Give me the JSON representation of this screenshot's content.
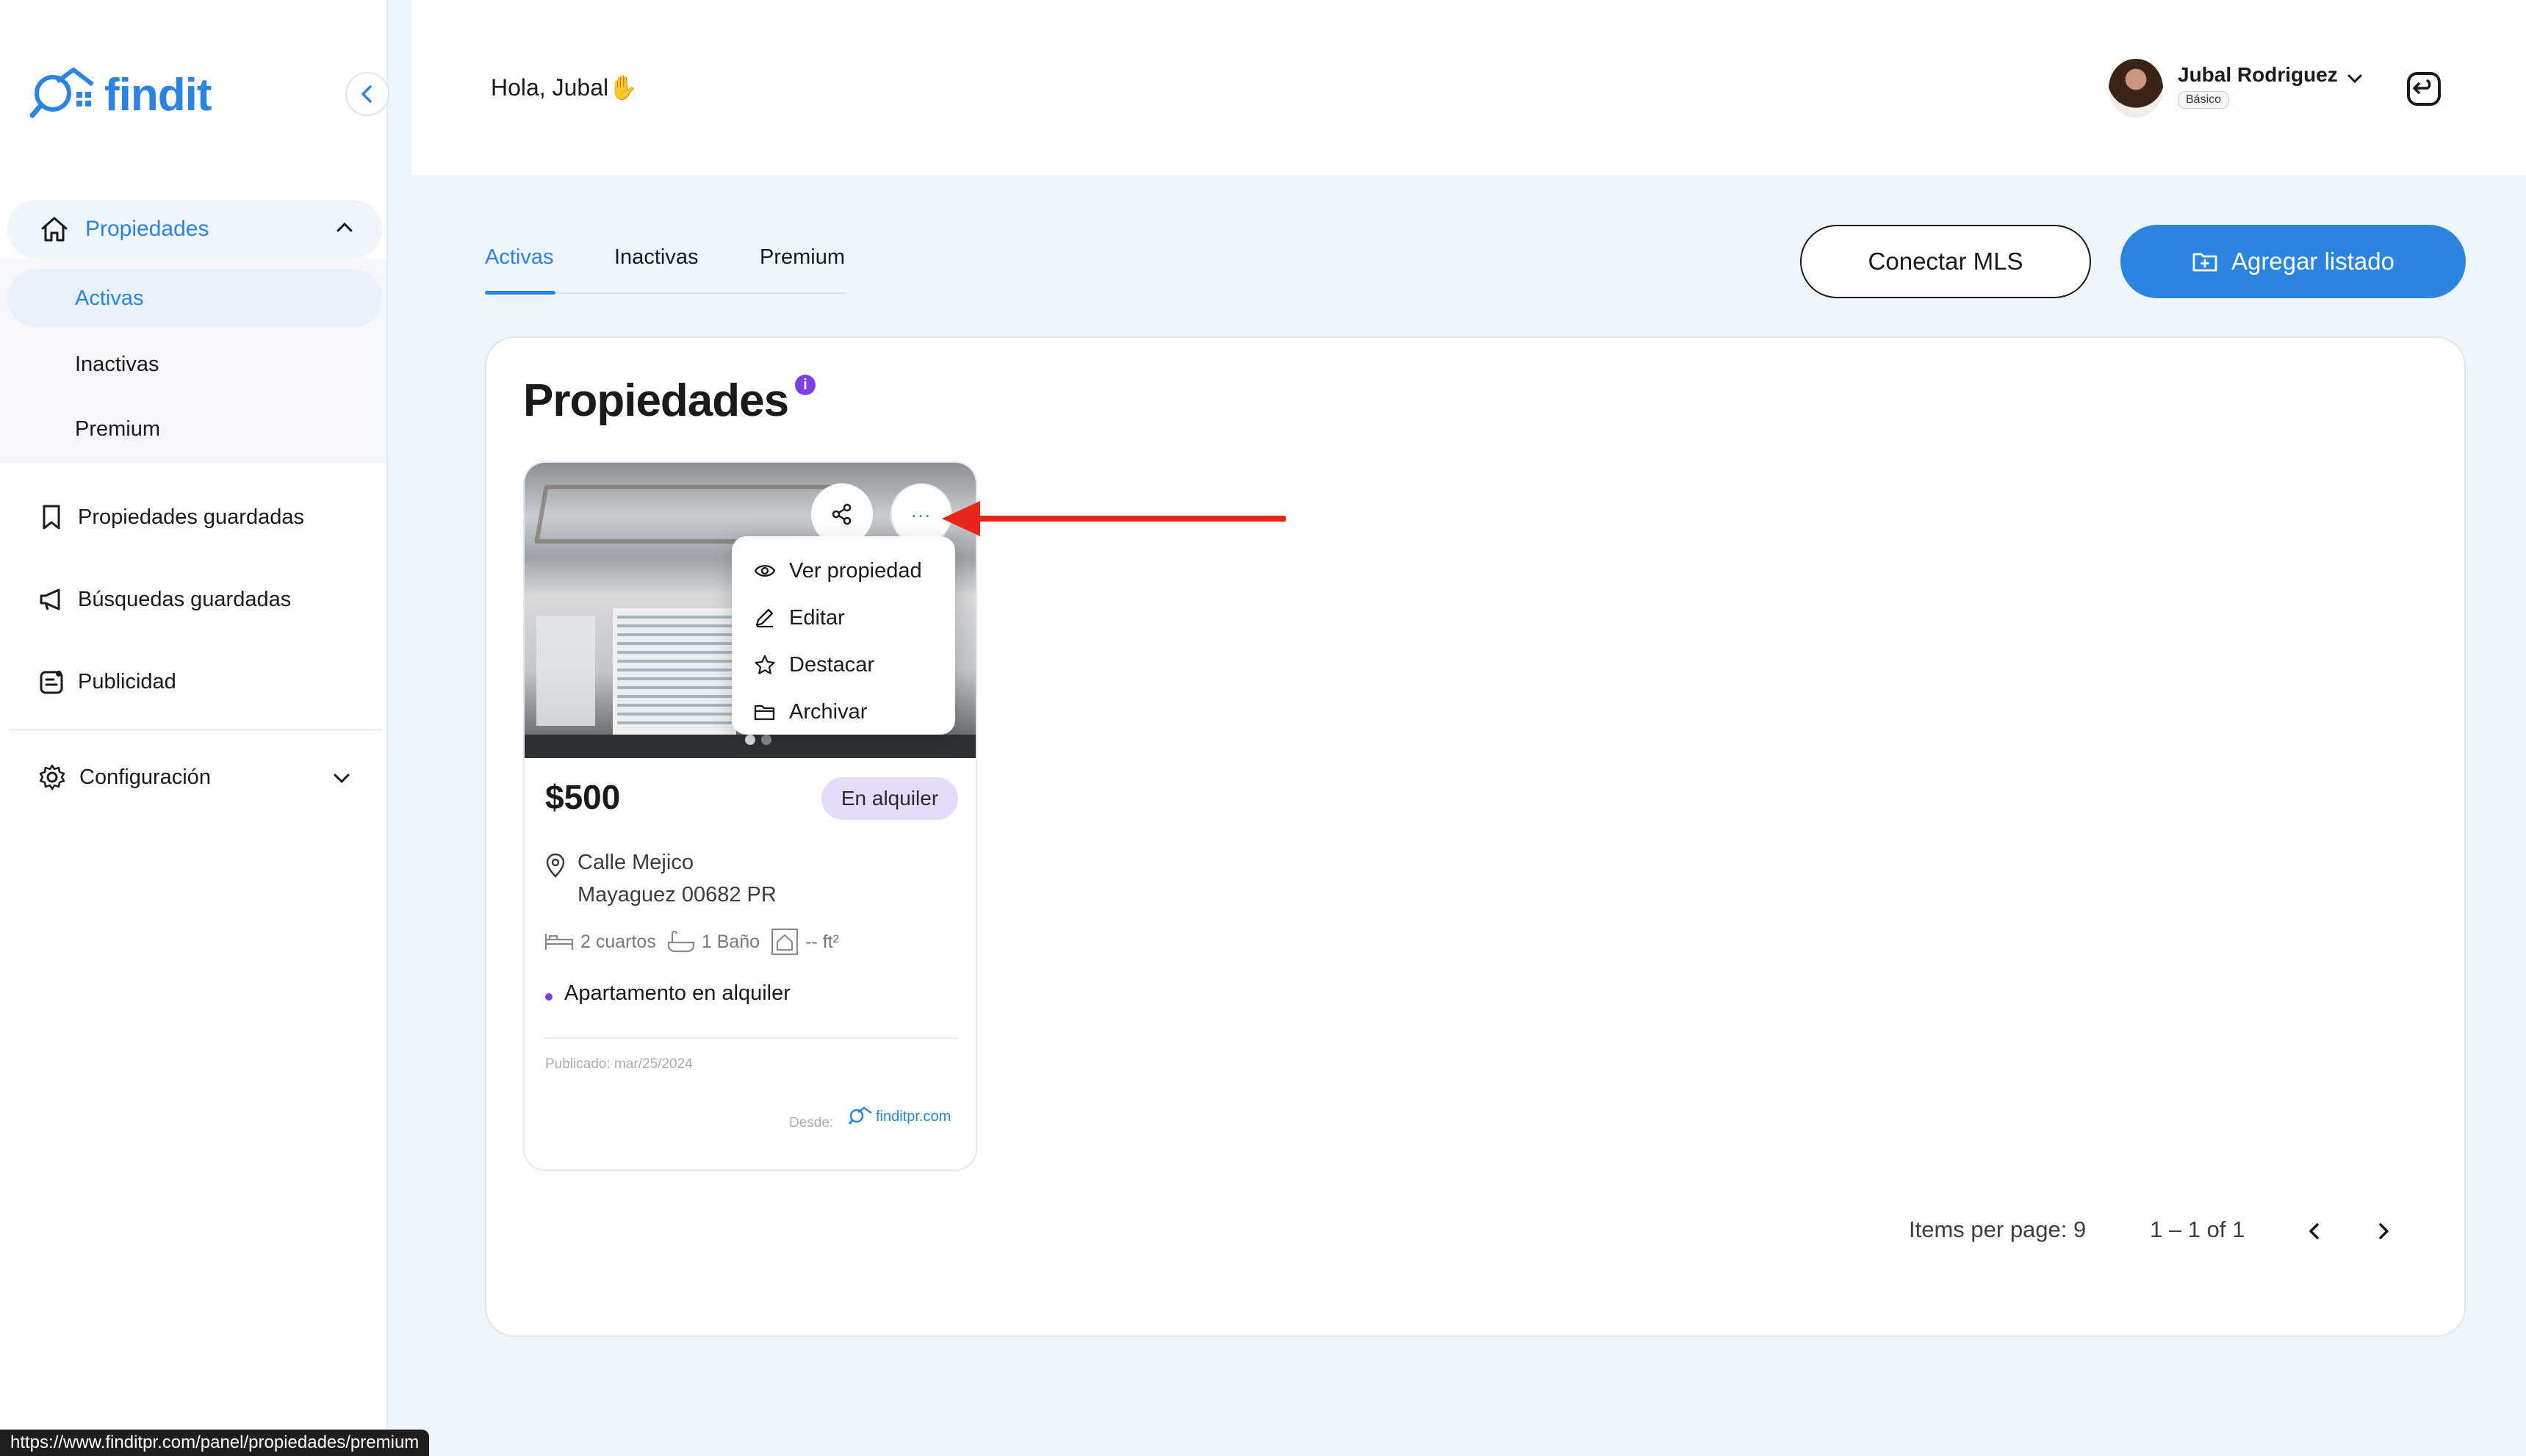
{
  "app": {
    "brand": "findit",
    "brand_color": "#2b84e0",
    "status_url": "https://www.finditpr.com/panel/propiedades/premium"
  },
  "sidebar": {
    "group": {
      "label": "Propiedades",
      "icon": "home-icon",
      "expanded": true
    },
    "sub_items": [
      {
        "label": "Activas",
        "active": true
      },
      {
        "label": "Inactivas",
        "active": false
      },
      {
        "label": "Premium",
        "active": false
      }
    ],
    "items": [
      {
        "label": "Propiedades guardadas",
        "icon": "bookmark-icon"
      },
      {
        "label": "Búsquedas guardadas",
        "icon": "megaphone-icon"
      },
      {
        "label": "Publicidad",
        "icon": "ad-icon"
      }
    ],
    "settings": {
      "label": "Configuración",
      "icon": "gear-icon"
    }
  },
  "header": {
    "greeting": "Hola, Jubal✋",
    "user": {
      "name": "Jubal Rodriguez",
      "plan": "Básico"
    }
  },
  "tabs": [
    {
      "label": "Activas",
      "active": true
    },
    {
      "label": "Inactivas",
      "active": false
    },
    {
      "label": "Premium",
      "active": false
    }
  ],
  "actions": {
    "connect_mls": "Conectar MLS",
    "add_listing": "Agregar listado"
  },
  "panel": {
    "title": "Propiedades",
    "info_glyph": "i"
  },
  "card": {
    "price": "$500",
    "badge": "En alquiler",
    "address_line1": "Calle Mejico",
    "address_line2": "Mayaguez 00682 PR",
    "rooms": "2 cuartos",
    "baths": "1 Baño",
    "area": "-- ft²",
    "type": "Apartamento en alquiler",
    "published": "Publicado: mar/25/2024",
    "source_label": "Desde:",
    "source_site": "finditpr.com",
    "more_glyph": "..."
  },
  "menu": [
    {
      "label": "Ver propiedad",
      "icon": "eye-icon"
    },
    {
      "label": "Editar",
      "icon": "pencil-icon"
    },
    {
      "label": "Destacar",
      "icon": "star-icon"
    },
    {
      "label": "Archivar",
      "icon": "folder-icon"
    }
  ],
  "pagination": {
    "items_per_page": "Items per page: 9",
    "range": "1 – 1 of 1"
  }
}
